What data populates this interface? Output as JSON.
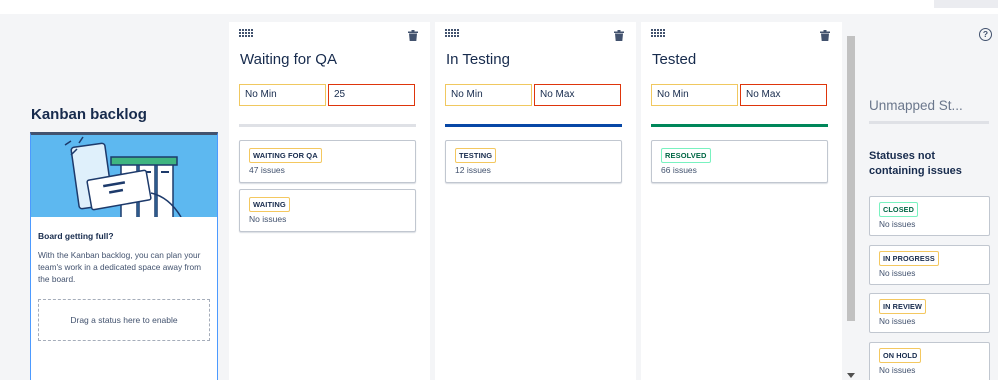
{
  "backlog": {
    "title": "Kanban backlog",
    "heading": "Board getting full?",
    "text": "With the Kanban backlog, you can plan your team's work in a dedicated space away from the board.",
    "dropzone": "Drag a status here to enable"
  },
  "columns": [
    {
      "title": "Waiting for QA",
      "min": "No Min",
      "max": "25",
      "divider_color": "#dfe1e6",
      "cards": [
        {
          "status": "WAITING FOR QA",
          "count": "47 issues"
        },
        {
          "status": "WAITING",
          "count": "No issues"
        }
      ]
    },
    {
      "title": "In Testing",
      "min": "No Min",
      "max": "No Max",
      "divider_color": "#0747a6",
      "cards": [
        {
          "status": "TESTING",
          "count": "12 issues"
        }
      ]
    },
    {
      "title": "Tested",
      "min": "No Min",
      "max": "No Max",
      "divider_color": "#00875a",
      "cards": [
        {
          "status": "RESOLVED",
          "count": "66 issues"
        }
      ]
    }
  ],
  "unmapped": {
    "title": "Unmapped St...",
    "subtitle": "Statuses not containing issues",
    "cards": [
      {
        "status": "CLOSED",
        "count": "No issues"
      },
      {
        "status": "IN PROGRESS",
        "count": "No issues"
      },
      {
        "status": "IN REVIEW",
        "count": "No issues"
      },
      {
        "status": "ON HOLD",
        "count": "No issues"
      }
    ]
  },
  "icons": {
    "drag": "drag-handle-icon",
    "delete": "trash-icon",
    "help": "help-icon"
  }
}
